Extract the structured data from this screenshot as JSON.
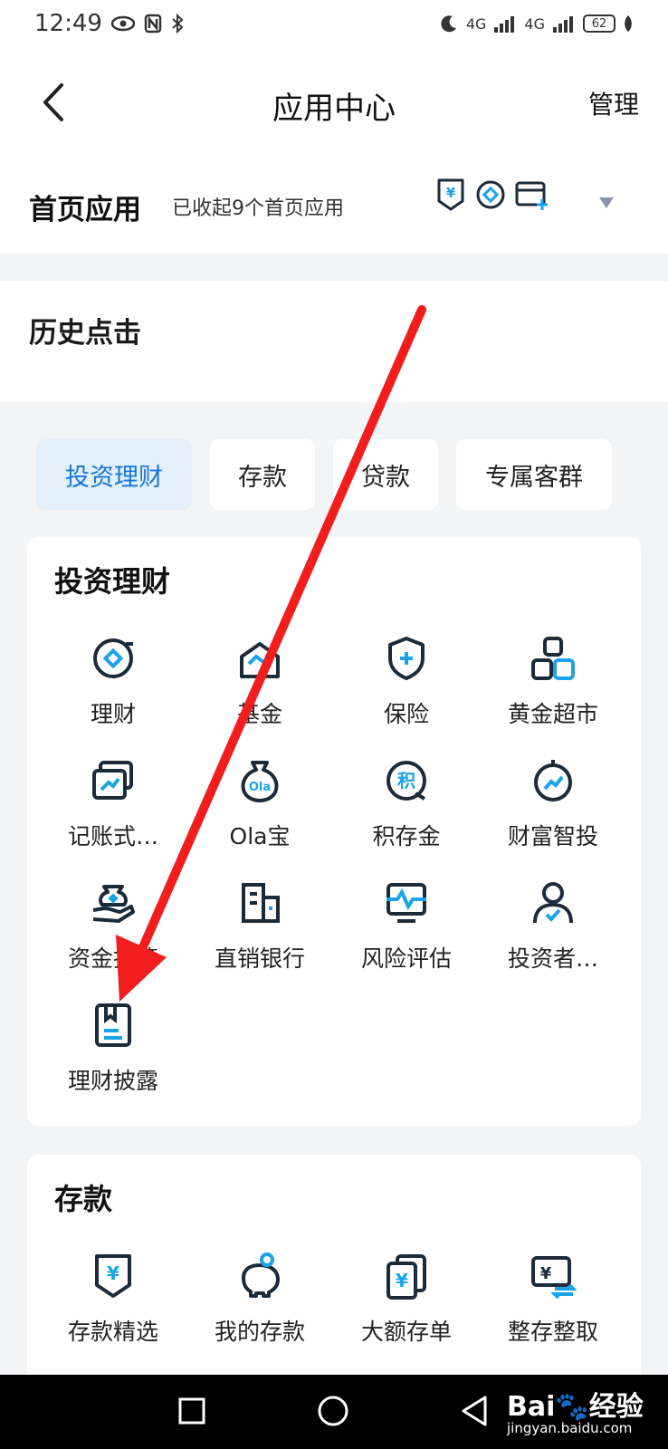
{
  "status": {
    "time": "12:49",
    "battery": "62",
    "network": "4G"
  },
  "header": {
    "title": "应用中心",
    "manage": "管理"
  },
  "home_apps": {
    "title": "首页应用",
    "subtitle": "已收起9个首页应用"
  },
  "history": {
    "title": "历史点击"
  },
  "tabs": [
    {
      "label": "投资理财",
      "active": true
    },
    {
      "label": "存款",
      "active": false
    },
    {
      "label": "贷款",
      "active": false
    },
    {
      "label": "专属客群",
      "active": false
    }
  ],
  "invest_section": {
    "title": "投资理财",
    "items": [
      {
        "label": "理财",
        "icon": "wealth-icon"
      },
      {
        "label": "基金",
        "icon": "fund-icon"
      },
      {
        "label": "保险",
        "icon": "insurance-shield-icon"
      },
      {
        "label": "黄金超市",
        "icon": "gold-market-icon"
      },
      {
        "label": "记账式…",
        "icon": "bookkeeping-bond-icon"
      },
      {
        "label": "Ola宝",
        "icon": "ola-bag-icon"
      },
      {
        "label": "积存金",
        "icon": "gold-accumulation-icon"
      },
      {
        "label": "财富智投",
        "icon": "smart-invest-icon"
      },
      {
        "label": "资金托管",
        "icon": "fund-custody-icon"
      },
      {
        "label": "直销银行",
        "icon": "direct-bank-icon"
      },
      {
        "label": "风险评估",
        "icon": "risk-assessment-icon"
      },
      {
        "label": "投资者…",
        "icon": "investor-icon"
      },
      {
        "label": "理财披露",
        "icon": "disclosure-book-icon"
      }
    ]
  },
  "deposit_section": {
    "title": "存款",
    "items": [
      {
        "label": "存款精选",
        "icon": "deposit-select-icon"
      },
      {
        "label": "我的存款",
        "icon": "piggy-bank-icon"
      },
      {
        "label": "大额存单",
        "icon": "large-deposit-icon"
      },
      {
        "label": "整存整取",
        "icon": "lump-deposit-icon"
      }
    ]
  },
  "watermark": {
    "brand": "Bai",
    "brand_tail": "经验",
    "url": "jingyan.baidu.com"
  },
  "colors": {
    "accent": "#1677d8",
    "icon_dark": "#1c2b3a",
    "icon_blue": "#1aa3e8",
    "arrow": "#f21d1d"
  }
}
